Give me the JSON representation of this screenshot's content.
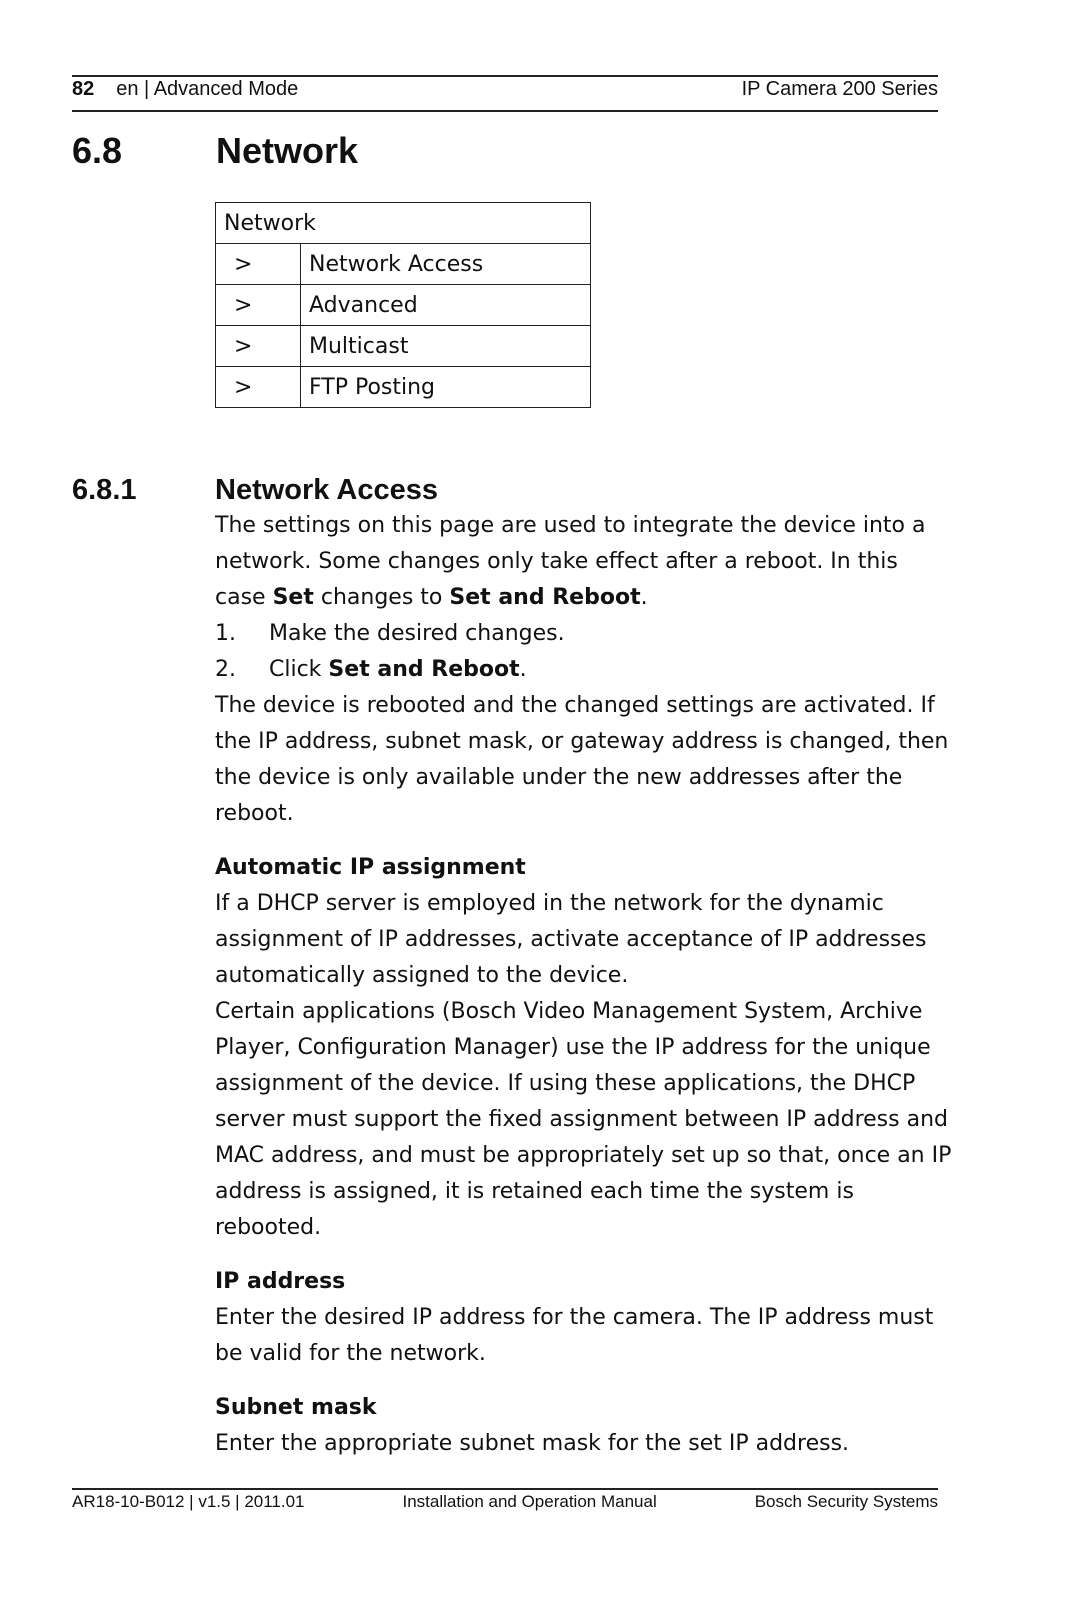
{
  "header": {
    "page_number": "82",
    "section": "en | Advanced Mode",
    "product": "IP Camera 200 Series"
  },
  "chapter": {
    "number": "6.8",
    "title": "Network"
  },
  "menu_table": {
    "title": "Network",
    "rows": [
      {
        "arrow": ">",
        "label": "Network Access"
      },
      {
        "arrow": ">",
        "label": "Advanced"
      },
      {
        "arrow": ">",
        "label": "Multicast"
      },
      {
        "arrow": ">",
        "label": "FTP Posting"
      }
    ]
  },
  "section": {
    "number": "6.8.1",
    "title": "Network Access",
    "intro_a": "The settings on this page are used to integrate the device into a network. Some changes only take effect after a reboot. In this case ",
    "intro_b1": "Set",
    "intro_c": " changes to ",
    "intro_b2": "Set and Reboot",
    "intro_d": ".",
    "steps": [
      {
        "n": "1.",
        "text": "Make the desired changes.",
        "bold": ""
      },
      {
        "n": "2.",
        "text": "Click ",
        "bold": "Set and Reboot",
        "tail": "."
      }
    ],
    "after_steps": "The device is rebooted and the changed settings are activated. If the IP address, subnet mask, or gateway address is changed, then the device is only available under the new addresses after the reboot.",
    "subsections": [
      {
        "title": "Automatic IP assignment",
        "paragraphs": [
          "If a DHCP server is employed in the network for the dynamic assignment of IP addresses, activate acceptance of IP addresses automatically assigned to the device.",
          "Certain applications (Bosch Video Management System, Archive Player, Configuration Manager) use the IP address for the unique assignment of the device. If using these applications, the DHCP server must support the fixed assignment between IP address and MAC address, and must be appropriately set up so that, once an IP address is assigned, it is retained each time the system is rebooted."
        ]
      },
      {
        "title": "IP address",
        "paragraphs": [
          "Enter the desired IP address for the camera. The IP address must be valid for the network."
        ]
      },
      {
        "title": "Subnet mask",
        "paragraphs": [
          "Enter the appropriate subnet mask for the set IP address."
        ]
      }
    ]
  },
  "footer": {
    "doc_id": "AR18-10-B012 | v1.5 | 2011.01",
    "doc_title": "Installation and Operation Manual",
    "company": "Bosch Security Systems"
  }
}
